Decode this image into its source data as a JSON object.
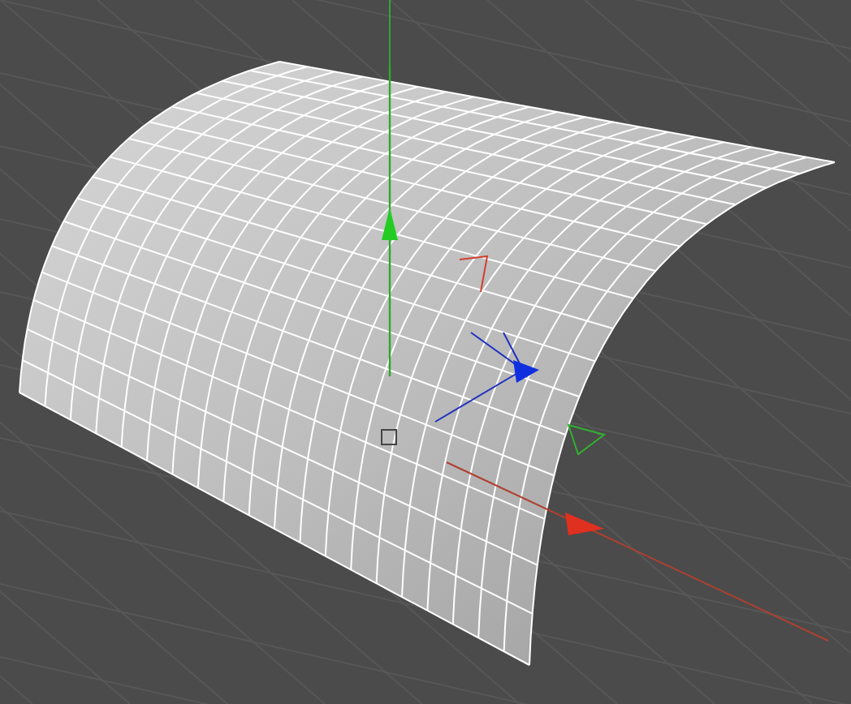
{
  "viewport": {
    "floor_grid": true,
    "axis_gizmo": true
  }
}
